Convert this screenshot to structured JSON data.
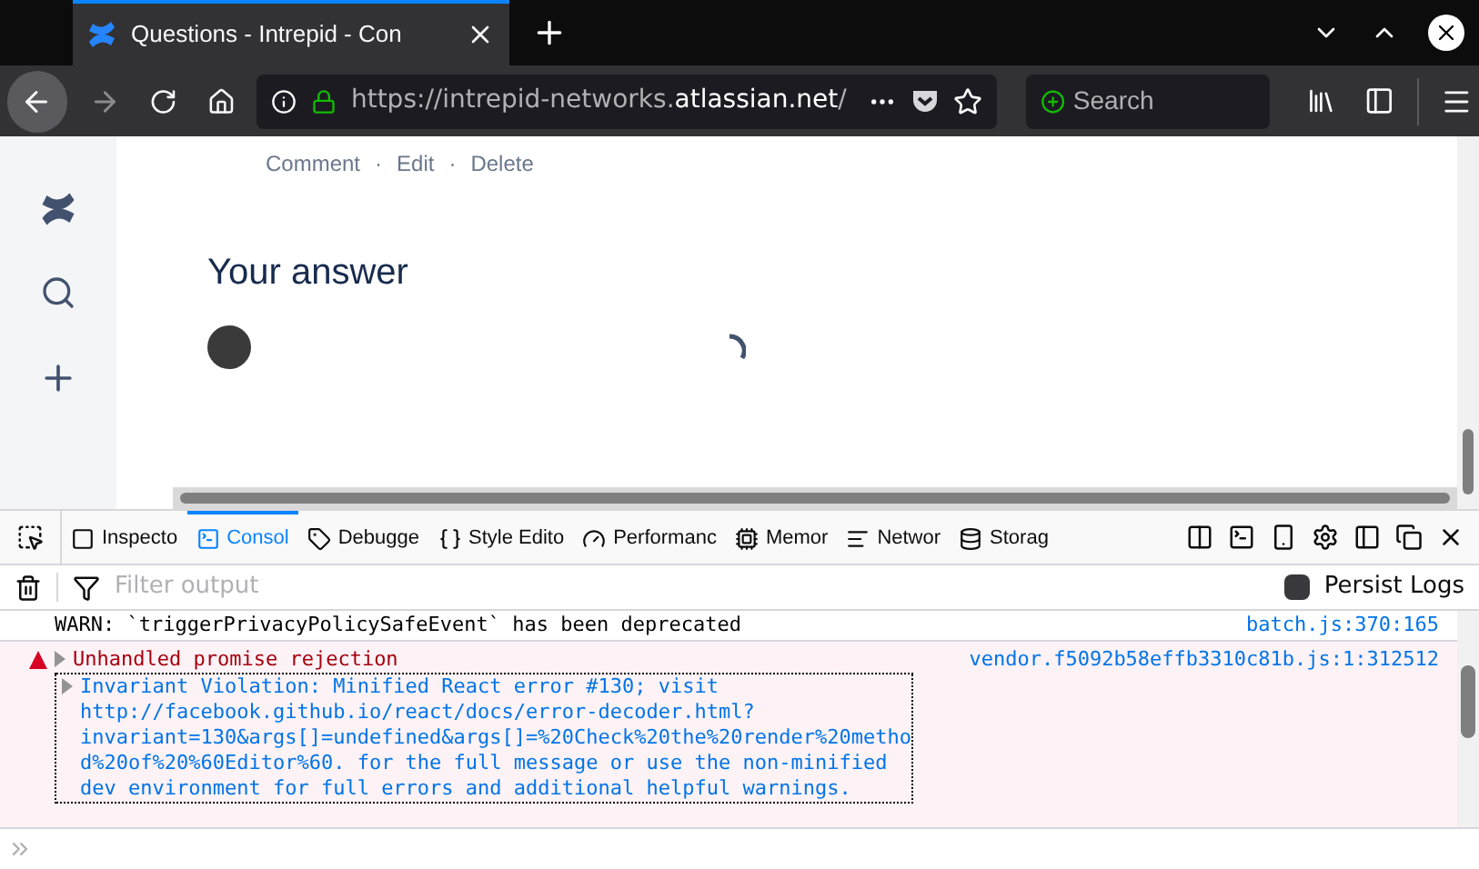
{
  "browser": {
    "tab": {
      "title": "Questions - Intrepid - Con"
    },
    "url": {
      "prefix": "https://intrepid-networks.",
      "domain": "atlassian.net",
      "suffix": "/"
    },
    "search": {
      "placeholder": "Search"
    }
  },
  "page": {
    "actions": [
      "Comment",
      "Edit",
      "Delete"
    ],
    "separator": "·",
    "heading": "Your answer"
  },
  "devtools": {
    "tabs": [
      {
        "label": "Inspecto",
        "selected": false,
        "kind": "inspector"
      },
      {
        "label": "Consol",
        "selected": true,
        "kind": "console"
      },
      {
        "label": "Debugge",
        "selected": false,
        "kind": "debugger"
      },
      {
        "label": "Style Edito",
        "selected": false,
        "kind": "style"
      },
      {
        "label": "Performanc",
        "selected": false,
        "kind": "performance"
      },
      {
        "label": "Memor",
        "selected": false,
        "kind": "memory"
      },
      {
        "label": "Networ",
        "selected": false,
        "kind": "network"
      },
      {
        "label": "Storag",
        "selected": false,
        "kind": "storage"
      }
    ],
    "filter": {
      "placeholder": "Filter output"
    },
    "persist_logs": {
      "label": "Persist Logs",
      "checked": false
    },
    "messages": [
      {
        "kind": "warn",
        "text": "WARN: `triggerPrivacyPolicySafeEvent` has been deprecated",
        "source": "batch.js:370:165"
      },
      {
        "kind": "error",
        "text": "Unhandled promise rejection",
        "source": "vendor.f5092b58effb3310c81b.js:1:312512",
        "detail": "Invariant Violation: Minified React error #130; visit http://facebook.github.io/react/docs/error-decoder.html?invariant=130&args[]=undefined&args[]=%20Check%20the%20render%20method%20of%20%60Editor%60. for the full message or use the non-minified dev environment for full errors and additional helpful warnings."
      }
    ]
  }
}
